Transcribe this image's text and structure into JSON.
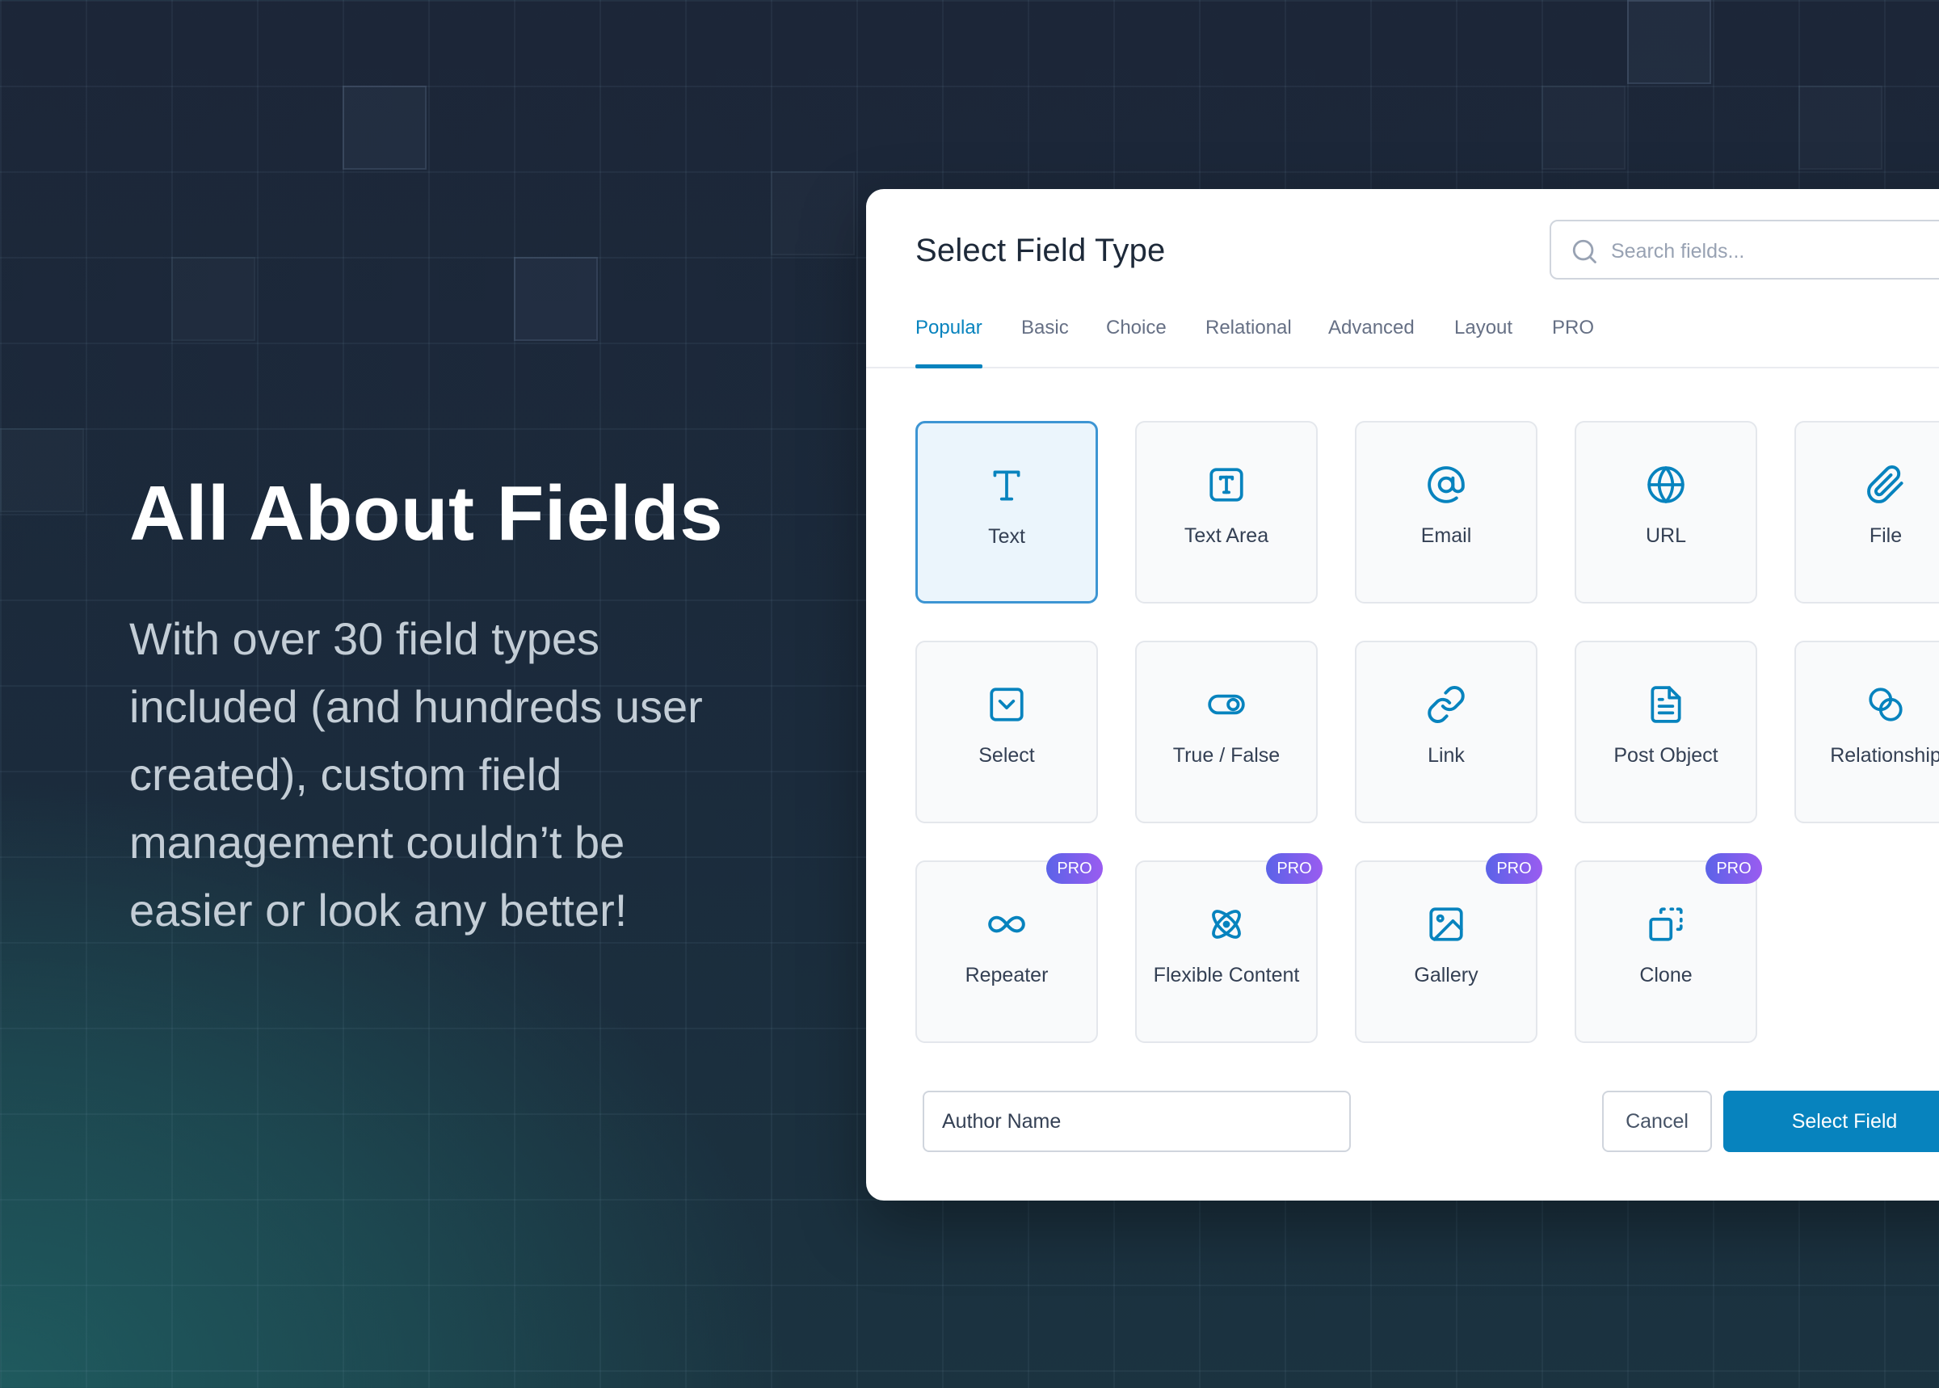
{
  "hero": {
    "title": "All About Fields",
    "description": "With over 30 field types included (and hundreds user created), custom field management couldn’t be easier or look any better!"
  },
  "dialog": {
    "title": "Select Field Type",
    "search_placeholder": "Search fields...",
    "tabs": [
      "Popular",
      "Basic",
      "Choice",
      "Relational",
      "Advanced",
      "Layout",
      "PRO"
    ],
    "active_tab": "Popular",
    "fields": [
      {
        "label": "Text",
        "icon": "text-icon",
        "selected": true
      },
      {
        "label": "Text Area",
        "icon": "textarea-icon"
      },
      {
        "label": "Email",
        "icon": "at-sign-icon"
      },
      {
        "label": "URL",
        "icon": "globe-icon"
      },
      {
        "label": "File",
        "icon": "paperclip-icon"
      },
      {
        "label": "Select",
        "icon": "select-chevron-icon"
      },
      {
        "label": "True / False",
        "icon": "toggle-icon"
      },
      {
        "label": "Link",
        "icon": "link-icon"
      },
      {
        "label": "Post Object",
        "icon": "document-icon"
      },
      {
        "label": "Relationship",
        "icon": "relationship-icon"
      },
      {
        "label": "Repeater",
        "icon": "infinity-icon",
        "badge": "PRO"
      },
      {
        "label": "Flexible Content",
        "icon": "atom-icon",
        "badge": "PRO"
      },
      {
        "label": "Gallery",
        "icon": "image-icon",
        "badge": "PRO"
      },
      {
        "label": "Clone",
        "icon": "clone-icon",
        "badge": "PRO"
      }
    ],
    "field_name_value": "Author Name",
    "cancel_label": "Cancel",
    "select_label": "Select Field"
  },
  "colors": {
    "accent": "#0783be",
    "pro_badge_start": "#5b63e8",
    "pro_badge_end": "#9a5cf0",
    "background": "#1c2638"
  }
}
